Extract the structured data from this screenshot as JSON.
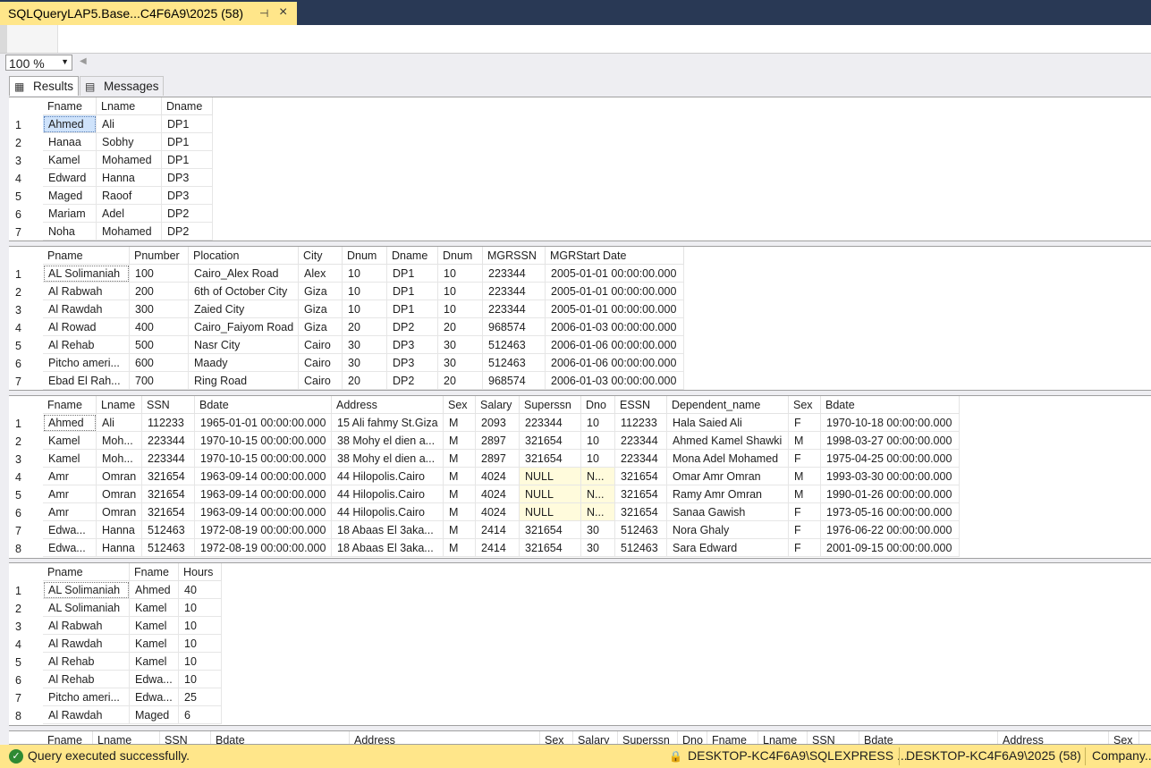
{
  "tab": {
    "title": "SQLQueryLAP5.Base...C4F6A9\\2025 (58)",
    "pin": "⊣",
    "close": "×"
  },
  "zoom": {
    "value": "100 %"
  },
  "result_tabs": [
    {
      "label": "Results",
      "icon": "grid-icon"
    },
    {
      "label": "Messages",
      "icon": "messages-icon"
    }
  ],
  "grids": [
    {
      "columns": [
        "Fname",
        "Lname",
        "Dname"
      ],
      "rows": [
        [
          "Ahmed",
          "Ali",
          "DP1"
        ],
        [
          "Hanaa",
          "Sobhy",
          "DP1"
        ],
        [
          "Kamel",
          "Mohamed",
          "DP1"
        ],
        [
          "Edward",
          "Hanna",
          "DP3"
        ],
        [
          "Maged",
          "Raoof",
          "DP3"
        ],
        [
          "Mariam",
          "Adel",
          "DP2"
        ],
        [
          "Noha",
          "Mohamed",
          "DP2"
        ]
      ]
    },
    {
      "columns": [
        "Pname",
        "Pnumber",
        "Plocation",
        "City",
        "Dnum",
        "Dname",
        "Dnum",
        "MGRSSN",
        "MGRStart Date"
      ],
      "rows": [
        [
          "AL Solimaniah",
          "100",
          "Cairo_Alex Road",
          "Alex",
          "10",
          "DP1",
          "10",
          "223344",
          "2005-01-01 00:00:00.000"
        ],
        [
          "Al Rabwah",
          "200",
          "6th of October City",
          "Giza",
          "10",
          "DP1",
          "10",
          "223344",
          "2005-01-01 00:00:00.000"
        ],
        [
          "Al Rawdah",
          "300",
          "Zaied City",
          "Giza",
          "10",
          "DP1",
          "10",
          "223344",
          "2005-01-01 00:00:00.000"
        ],
        [
          "Al Rowad",
          "400",
          "Cairo_Faiyom Road",
          "Giza",
          "20",
          "DP2",
          "20",
          "968574",
          "2006-01-03 00:00:00.000"
        ],
        [
          "Al Rehab",
          "500",
          "Nasr City",
          "Cairo",
          "30",
          "DP3",
          "30",
          "512463",
          "2006-01-06 00:00:00.000"
        ],
        [
          "Pitcho ameri...",
          "600",
          "Maady",
          "Cairo",
          "30",
          "DP3",
          "30",
          "512463",
          "2006-01-06 00:00:00.000"
        ],
        [
          "Ebad El Rah...",
          "700",
          "Ring Road",
          "Cairo",
          "20",
          "DP2",
          "20",
          "968574",
          "2006-01-03 00:00:00.000"
        ]
      ]
    },
    {
      "columns": [
        "Fname",
        "Lname",
        "SSN",
        "Bdate",
        "Address",
        "Sex",
        "Salary",
        "Superssn",
        "Dno",
        "ESSN",
        "Dependent_name",
        "Sex",
        "Bdate"
      ],
      "rows": [
        [
          "Ahmed",
          "Ali",
          "112233",
          "1965-01-01 00:00:00.000",
          "15 Ali fahmy St.Giza",
          "M",
          "2093",
          "223344",
          "10",
          "112233",
          "Hala Saied Ali",
          "F",
          "1970-10-18 00:00:00.000"
        ],
        [
          "Kamel",
          "Moh...",
          "223344",
          "1970-10-15 00:00:00.000",
          "38 Mohy el dien a...",
          "M",
          "2897",
          "321654",
          "10",
          "223344",
          "Ahmed Kamel Shawki",
          "M",
          "1998-03-27 00:00:00.000"
        ],
        [
          "Kamel",
          "Moh...",
          "223344",
          "1970-10-15 00:00:00.000",
          "38 Mohy el dien a...",
          "M",
          "2897",
          "321654",
          "10",
          "223344",
          "Mona Adel Mohamed",
          "F",
          "1975-04-25 00:00:00.000"
        ],
        [
          "Amr",
          "Omran",
          "321654",
          "1963-09-14 00:00:00.000",
          "44 Hilopolis.Cairo",
          "M",
          "4024",
          "NULL",
          "N...",
          "321654",
          "Omar Amr Omran",
          "M",
          "1993-03-30 00:00:00.000"
        ],
        [
          "Amr",
          "Omran",
          "321654",
          "1963-09-14 00:00:00.000",
          "44 Hilopolis.Cairo",
          "M",
          "4024",
          "NULL",
          "N...",
          "321654",
          "Ramy Amr Omran",
          "M",
          "1990-01-26 00:00:00.000"
        ],
        [
          "Amr",
          "Omran",
          "321654",
          "1963-09-14 00:00:00.000",
          "44 Hilopolis.Cairo",
          "M",
          "4024",
          "NULL",
          "N...",
          "321654",
          "Sanaa Gawish",
          "F",
          "1973-05-16 00:00:00.000"
        ],
        [
          "Edwa...",
          "Hanna",
          "512463",
          "1972-08-19 00:00:00.000",
          "18 Abaas El 3aka...",
          "M",
          "2414",
          "321654",
          "30",
          "512463",
          "Nora Ghaly",
          "F",
          "1976-06-22 00:00:00.000"
        ],
        [
          "Edwa...",
          "Hanna",
          "512463",
          "1972-08-19 00:00:00.000",
          "18 Abaas El 3aka...",
          "M",
          "2414",
          "321654",
          "30",
          "512463",
          "Sara Edward",
          "F",
          "2001-09-15 00:00:00.000"
        ]
      ]
    },
    {
      "columns": [
        "Pname",
        "Fname",
        "Hours"
      ],
      "rows": [
        [
          "AL Solimaniah",
          "Ahmed",
          "40"
        ],
        [
          "AL Solimaniah",
          "Kamel",
          "10"
        ],
        [
          "Al Rabwah",
          "Kamel",
          "10"
        ],
        [
          "Al Rawdah",
          "Kamel",
          "10"
        ],
        [
          "Al Rehab",
          "Kamel",
          "10"
        ],
        [
          "Al Rehab",
          "Edwa...",
          "10"
        ],
        [
          "Pitcho ameri...",
          "Edwa...",
          "25"
        ],
        [
          "Al Rawdah",
          "Maged",
          "6"
        ]
      ]
    },
    {
      "columns": [
        "Fname",
        "Lname",
        "SSN",
        "Bdate",
        "Address",
        "Sex",
        "Salary",
        "Superssn",
        "Dno",
        "Fname",
        "Lname",
        "SSN",
        "Bdate",
        "Address",
        "Sex"
      ],
      "rows": []
    }
  ],
  "status": {
    "message": "Query executed successfully.",
    "server": "DESKTOP-KC4F6A9\\SQLEXPRESS ...",
    "connection": "DESKTOP-KC4F6A9\\2025 (58)",
    "database": "Company..."
  }
}
